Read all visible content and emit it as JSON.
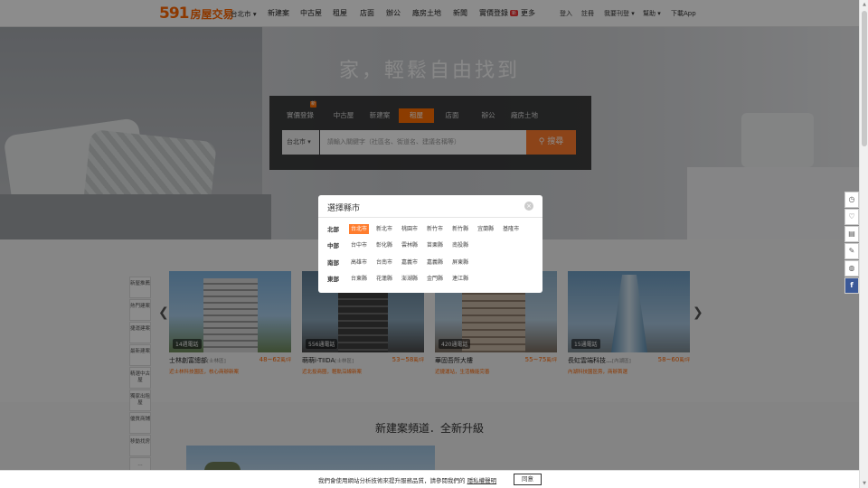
{
  "brand": {
    "number": "591",
    "name": "房屋交易"
  },
  "nav": {
    "city": "台北市 ▾",
    "items": [
      "新建案",
      "中古屋",
      "租屋",
      "店面",
      "辦公",
      "廠房土地",
      "新聞",
      "實價登錄"
    ],
    "new_badge": "新",
    "more": "更多",
    "right": {
      "login": "登入",
      "register": "註冊",
      "publish": "我要刊登 ▾",
      "help": "幫助 ▾",
      "app": "下載App"
    }
  },
  "hero": {
    "slogan": "家，輕鬆自由找到"
  },
  "search": {
    "tabs": [
      "實價登錄",
      "中古屋",
      "新建案",
      "租屋",
      "店面",
      "辦公",
      "廠房土地"
    ],
    "active_tab": "租屋",
    "tab_badge": "新",
    "city": "台北市 ▾",
    "placeholder": "請輸入關鍵字（社區名、街道名、建議名稱等）",
    "button": "搜尋"
  },
  "modal": {
    "title": "選擇縣市",
    "close": "×",
    "regions": [
      {
        "label": "北部",
        "cities": [
          "台北市",
          "新北市",
          "桃園市",
          "新竹市",
          "新竹縣",
          "宜蘭縣",
          "基隆市"
        ]
      },
      {
        "label": "中部",
        "cities": [
          "台中市",
          "彰化縣",
          "雲林縣",
          "苗栗縣",
          "南投縣"
        ]
      },
      {
        "label": "南部",
        "cities": [
          "高雄市",
          "台南市",
          "嘉義市",
          "嘉義縣",
          "屏東縣"
        ]
      },
      {
        "label": "東部",
        "cities": [
          "台東縣",
          "花蓮縣",
          "澎湖縣",
          "金門縣",
          "連江縣"
        ]
      }
    ],
    "selected_city": "台北市"
  },
  "side_tabs": [
    "新屋推薦",
    "熱門建案",
    "捷運建案",
    "最新建案",
    "精選中古屋",
    "獨家出租屋",
    "優質商鋪",
    "移動找房",
    "…"
  ],
  "listings": [
    {
      "caption": "14週電話",
      "name": "士林創富總部",
      "area": "[士林區]",
      "price": "48~62",
      "unit": "萬/坪",
      "note": "近士林科技園區，核心商辦新案"
    },
    {
      "caption": "556通電話",
      "name": "萌萌i-TIIDA",
      "area": "[士林區]",
      "price": "53~58",
      "unit": "萬/坪",
      "note": "近北投商圈，輕軌沿線新案"
    },
    {
      "caption": "420通電話",
      "name": "華固吾所大樓",
      "area": "[士林區]",
      "price": "55~75",
      "unit": "萬/坪",
      "note": "近捷運站，生活機能完善"
    },
    {
      "caption": "15通電話",
      "name": "長虹雲端科技…",
      "area": "[內湖區]",
      "price": "58~60",
      "unit": "萬/坪",
      "note": "內湖科技園區旁，商辦首選"
    }
  ],
  "float_bar": [
    "◷",
    "♡",
    "▤",
    "✎",
    "◍",
    "f"
  ],
  "section": {
    "title": "新建案頻道．全新升級"
  },
  "cookie": {
    "text": "我們會使用網站分析技術來提升服務品質，請參閱我們的",
    "link": "隱私權聲明",
    "button": "同意"
  },
  "colors": {
    "brand": "#ff6600",
    "accent": "#ff7d2e",
    "price": "#ff6600"
  }
}
